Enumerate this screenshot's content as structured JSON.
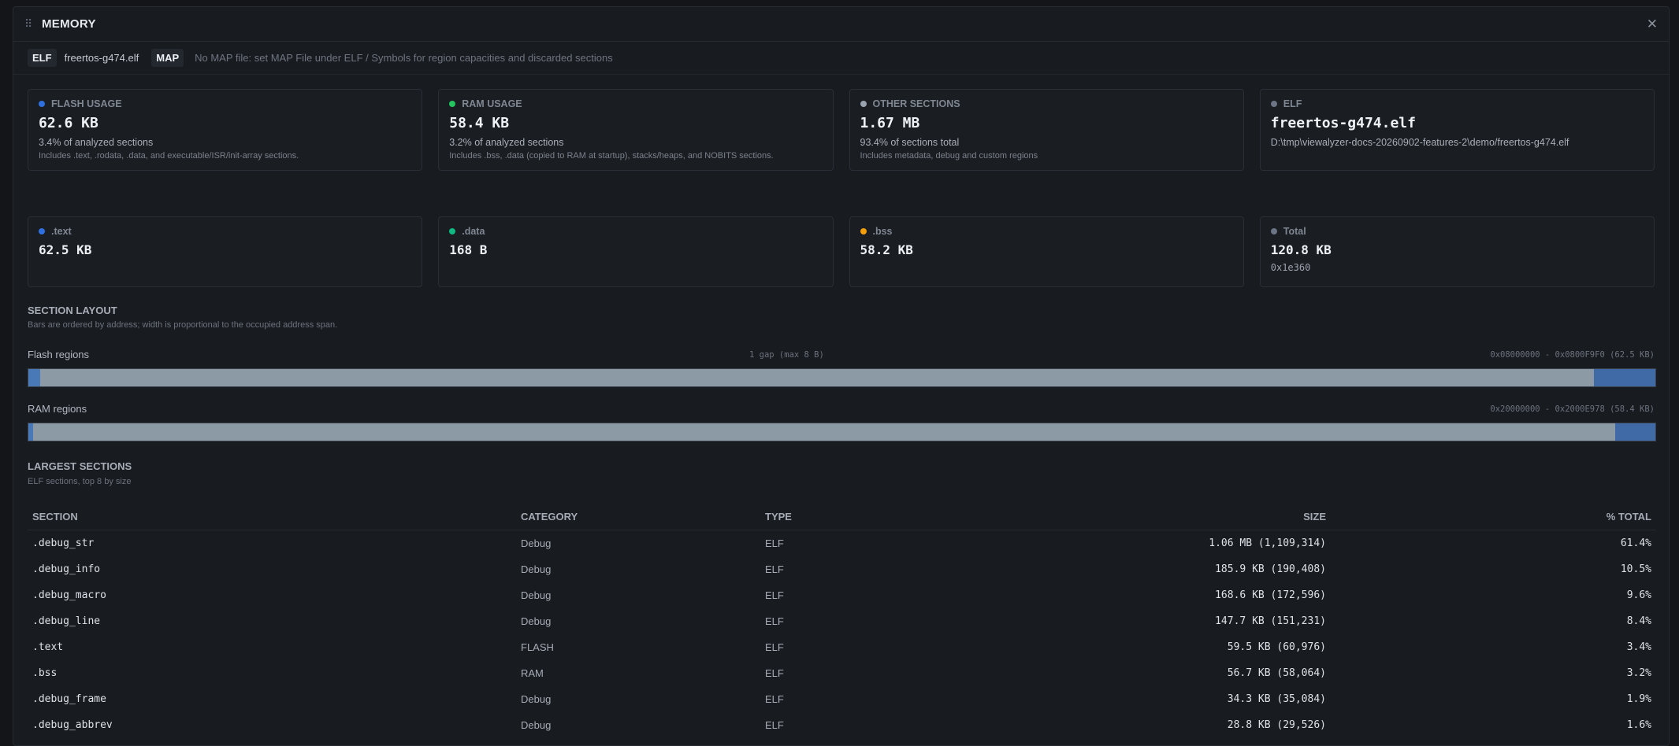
{
  "window": {
    "title": "MEMORY",
    "grip_icon": "⠿",
    "close_icon": "✕"
  },
  "filebar": {
    "elf_tag": "ELF",
    "elf_file": "freertos-g474.elf",
    "map_tag": "MAP",
    "map_note": "No MAP file: set MAP File under ELF / Symbols for region capacities and discarded sections"
  },
  "cards": [
    {
      "label": "FLASH USAGE",
      "color": "#2f6fe0",
      "value": "62.6 KB",
      "sub": "3.4% of analyzed sections",
      "note": "Includes .text, .rodata, .data, and executable/ISR/init-array sections."
    },
    {
      "label": "RAM USAGE",
      "color": "#22c55e",
      "value": "58.4 KB",
      "sub": "3.2% of analyzed sections",
      "note": "Includes .bss, .data (copied to RAM at startup), stacks/heaps, and NOBITS sections."
    },
    {
      "label": "OTHER SECTIONS",
      "color": "#9aa3b0",
      "value": "1.67 MB",
      "sub": "93.4% of sections total",
      "note": "Includes metadata, debug and custom regions"
    },
    {
      "label": "ELF",
      "color": "#6b7585",
      "value": "freertos-g474.elf",
      "sub": "D:\\tmp\\viewalyzer-docs-20260902-features-2\\demo/freertos-g474.elf",
      "note": ""
    }
  ],
  "stats": [
    {
      "label": ".text",
      "color": "#2f6fe0",
      "value": "62.5 KB",
      "extra": ""
    },
    {
      "label": ".data",
      "color": "#10b981",
      "value": "168 B",
      "extra": ""
    },
    {
      "label": ".bss",
      "color": "#f59e0b",
      "value": "58.2 KB",
      "extra": ""
    },
    {
      "label": "Total",
      "color": "#6b7585",
      "value": "120.8 KB",
      "extra": "0x1e360"
    }
  ],
  "layout": {
    "title": "SECTION LAYOUT",
    "subtitle": "Bars are ordered by address; width is proportional to the occupied address span.",
    "flash": {
      "label": "Flash regions",
      "gap_note": "1 gap (max 8 B)",
      "range": "0x08000000 - 0x0800F9F0 (62.5 KB)"
    },
    "ram": {
      "label": "RAM regions",
      "range": "0x20000000 - 0x2000E978 (58.4 KB)"
    }
  },
  "largest": {
    "title": "LARGEST SECTIONS",
    "subtitle": "ELF sections, top 8 by size",
    "headers": [
      "SECTION",
      "CATEGORY",
      "TYPE",
      "SIZE",
      "% TOTAL"
    ],
    "rows": [
      {
        "section": ".debug_str",
        "category": "Debug",
        "type": "ELF",
        "size": "1.06 MB (1,109,314)",
        "pct": "61.4%"
      },
      {
        "section": ".debug_info",
        "category": "Debug",
        "type": "ELF",
        "size": "185.9 KB (190,408)",
        "pct": "10.5%"
      },
      {
        "section": ".debug_macro",
        "category": "Debug",
        "type": "ELF",
        "size": "168.6 KB (172,596)",
        "pct": "9.6%"
      },
      {
        "section": ".debug_line",
        "category": "Debug",
        "type": "ELF",
        "size": "147.7 KB (151,231)",
        "pct": "8.4%"
      },
      {
        "section": ".text",
        "category": "FLASH",
        "type": "ELF",
        "size": "59.5 KB (60,976)",
        "pct": "3.4%"
      },
      {
        "section": ".bss",
        "category": "RAM",
        "type": "ELF",
        "size": "56.7 KB (58,064)",
        "pct": "3.2%"
      },
      {
        "section": ".debug_frame",
        "category": "Debug",
        "type": "ELF",
        "size": "34.3 KB (35,084)",
        "pct": "1.9%"
      },
      {
        "section": ".debug_abbrev",
        "category": "Debug",
        "type": "ELF",
        "size": "28.8 KB (29,526)",
        "pct": "1.6%"
      }
    ]
  }
}
